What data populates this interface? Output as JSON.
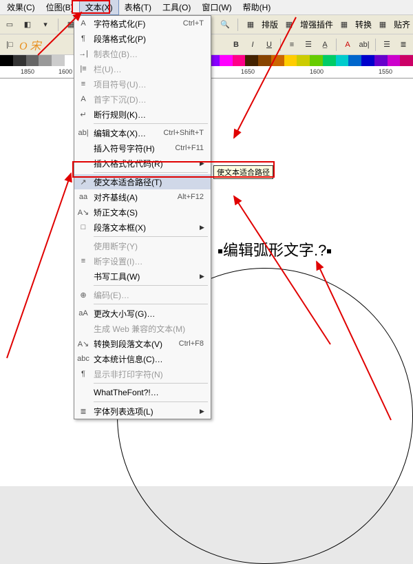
{
  "menubar": {
    "items": [
      "效果(C)",
      "位图(B)",
      "文本(X)",
      "表格(T)",
      "工具(O)",
      "窗口(W)",
      "帮助(H)"
    ]
  },
  "toolbar_right": {
    "items": [
      "排版",
      "增强插件",
      "转换",
      "贴齐"
    ]
  },
  "ruler": {
    "ticks": [
      "1850",
      "1600",
      "1650",
      "1600",
      "1550"
    ]
  },
  "dropdown": {
    "items": [
      {
        "icon": "A",
        "label": "字符格式化(F)",
        "shortcut": "Ctrl+T"
      },
      {
        "icon": "¶",
        "label": "段落格式化(P)"
      },
      {
        "icon": "→|",
        "label": "制表位(B)…",
        "disabled": true
      },
      {
        "icon": "|≡",
        "label": "栏(U)…",
        "disabled": true
      },
      {
        "icon": "≡",
        "label": "项目符号(U)…",
        "disabled": true
      },
      {
        "icon": "A",
        "label": "首字下沉(D)…",
        "disabled": true
      },
      {
        "icon": "↵",
        "label": "断行规则(K)…"
      },
      {
        "sep": true
      },
      {
        "icon": "ab|",
        "label": "编辑文本(X)…",
        "shortcut": "Ctrl+Shift+T"
      },
      {
        "label": "插入符号字符(H)",
        "shortcut": "Ctrl+F11"
      },
      {
        "label": "插入格式化代码(R)",
        "arrow": true
      },
      {
        "sep": true
      },
      {
        "icon": "↗",
        "label": "使文本适合路径(T)",
        "hl": true
      },
      {
        "icon": "aa",
        "label": "对齐基线(A)",
        "shortcut": "Alt+F12"
      },
      {
        "icon": "A↘",
        "label": "矫正文本(S)"
      },
      {
        "icon": "□",
        "label": "段落文本框(X)",
        "arrow": true
      },
      {
        "sep": true
      },
      {
        "label": "使用断字(Y)",
        "disabled": true
      },
      {
        "icon": "≡",
        "label": "断字设置(I)…",
        "disabled": true
      },
      {
        "label": "书写工具(W)",
        "arrow": true
      },
      {
        "sep": true
      },
      {
        "icon": "⊕",
        "label": "编码(E)…",
        "disabled": true
      },
      {
        "sep": true
      },
      {
        "icon": "aA",
        "label": "更改大小写(G)…"
      },
      {
        "label": "生成 Web 兼容的文本(M)",
        "disabled": true
      },
      {
        "icon": "A↘",
        "label": "转换到段落文本(V)",
        "shortcut": "Ctrl+F8"
      },
      {
        "icon": "abc",
        "label": "文本统计信息(C)…"
      },
      {
        "icon": "¶",
        "label": "显示非打印字符(N)",
        "disabled": true
      },
      {
        "sep": true
      },
      {
        "label": "WhatTheFont?!…"
      },
      {
        "sep": true
      },
      {
        "icon": "≣",
        "label": "字体列表选项(L)",
        "arrow": true
      }
    ]
  },
  "tooltip": "使文本适合路径",
  "canvas_text": "编辑弧形文字.?",
  "colors": [
    "#000",
    "#333",
    "#666",
    "#999",
    "#ccc",
    "#fff",
    "#800",
    "#f00",
    "#f80",
    "#ff0",
    "#8f0",
    "#0f0",
    "#0f8",
    "#0ff",
    "#08f",
    "#00f",
    "#80f",
    "#f0f",
    "#f08",
    "#420",
    "#840",
    "#c60",
    "#fc0",
    "#cc0",
    "#6c0",
    "#0c6",
    "#0cc",
    "#06c",
    "#00c",
    "#60c",
    "#c0c",
    "#c06"
  ]
}
